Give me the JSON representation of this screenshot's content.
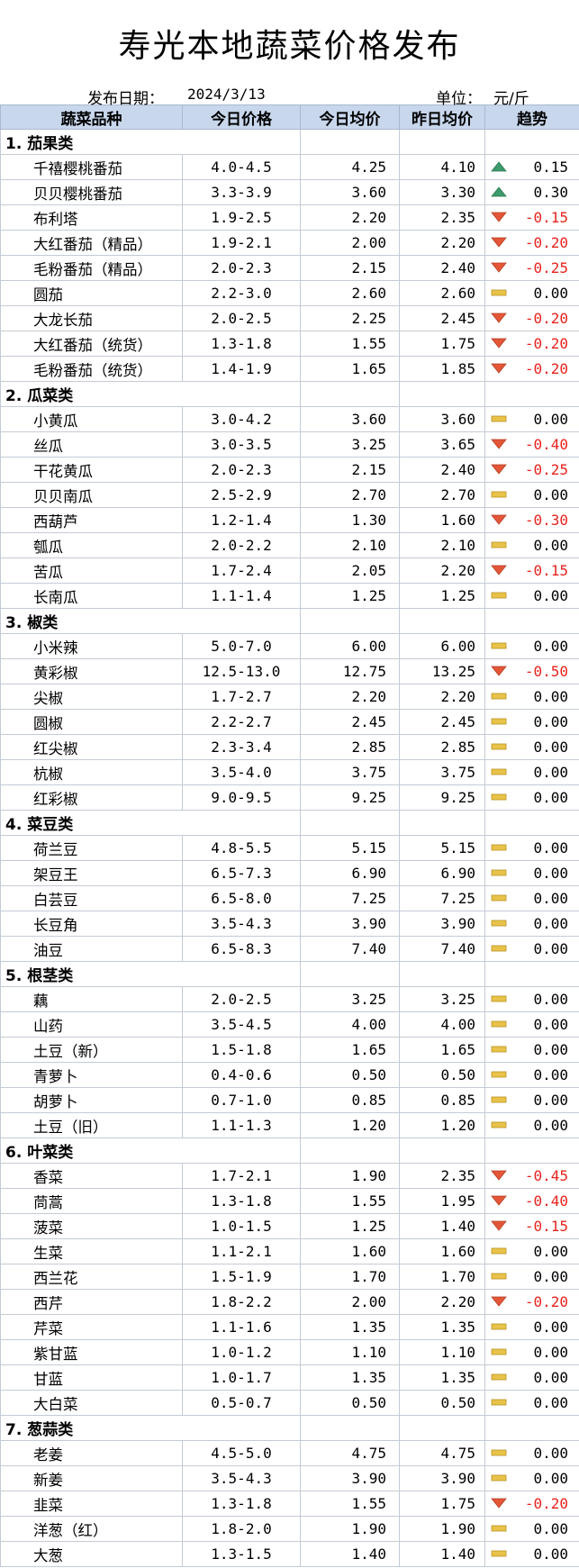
{
  "title": "寿光本地蔬菜价格发布",
  "date_label": "发布日期：",
  "date": "2024/3/13",
  "unit_label": "单位：",
  "unit": "元/斤",
  "headers": [
    "蔬菜品种",
    "今日价格",
    "今日均价",
    "昨日均价",
    "趋势"
  ],
  "colors": {
    "header_bg": "#c8d7ec",
    "up": "#3e9a6a",
    "down": "#e45638",
    "flat": "#e9c24a",
    "negative_text": "#e8231d"
  },
  "categories": [
    {
      "name": "1. 茄果类",
      "items": [
        {
          "name": "千禧樱桃番茄",
          "price": "4.0-4.5",
          "today": "4.25",
          "yesterday": "4.10",
          "trend": "up",
          "change": "0.15"
        },
        {
          "name": "贝贝樱桃番茄",
          "price": "3.3-3.9",
          "today": "3.60",
          "yesterday": "3.30",
          "trend": "up",
          "change": "0.30"
        },
        {
          "name": "布利塔",
          "price": "1.9-2.5",
          "today": "2.20",
          "yesterday": "2.35",
          "trend": "down",
          "change": "-0.15"
        },
        {
          "name": "大红番茄（精品）",
          "price": "1.9-2.1",
          "today": "2.00",
          "yesterday": "2.20",
          "trend": "down",
          "change": "-0.20"
        },
        {
          "name": "毛粉番茄（精品）",
          "price": "2.0-2.3",
          "today": "2.15",
          "yesterday": "2.40",
          "trend": "down",
          "change": "-0.25"
        },
        {
          "name": "圆茄",
          "price": "2.2-3.0",
          "today": "2.60",
          "yesterday": "2.60",
          "trend": "flat",
          "change": "0.00"
        },
        {
          "name": "大龙长茄",
          "price": "2.0-2.5",
          "today": "2.25",
          "yesterday": "2.45",
          "trend": "down",
          "change": "-0.20"
        },
        {
          "name": "大红番茄（统货）",
          "price": "1.3-1.8",
          "today": "1.55",
          "yesterday": "1.75",
          "trend": "down",
          "change": "-0.20"
        },
        {
          "name": "毛粉番茄（统货）",
          "price": "1.4-1.9",
          "today": "1.65",
          "yesterday": "1.85",
          "trend": "down",
          "change": "-0.20"
        }
      ]
    },
    {
      "name": "2. 瓜菜类",
      "items": [
        {
          "name": "小黄瓜",
          "price": "3.0-4.2",
          "today": "3.60",
          "yesterday": "3.60",
          "trend": "flat",
          "change": "0.00"
        },
        {
          "name": "丝瓜",
          "price": "3.0-3.5",
          "today": "3.25",
          "yesterday": "3.65",
          "trend": "down",
          "change": "-0.40"
        },
        {
          "name": "干花黄瓜",
          "price": "2.0-2.3",
          "today": "2.15",
          "yesterday": "2.40",
          "trend": "down",
          "change": "-0.25"
        },
        {
          "name": "贝贝南瓜",
          "price": "2.5-2.9",
          "today": "2.70",
          "yesterday": "2.70",
          "trend": "flat",
          "change": "0.00"
        },
        {
          "name": "西葫芦",
          "price": "1.2-1.4",
          "today": "1.30",
          "yesterday": "1.60",
          "trend": "down",
          "change": "-0.30"
        },
        {
          "name": "瓠瓜",
          "price": "2.0-2.2",
          "today": "2.10",
          "yesterday": "2.10",
          "trend": "flat",
          "change": "0.00"
        },
        {
          "name": "苦瓜",
          "price": "1.7-2.4",
          "today": "2.05",
          "yesterday": "2.20",
          "trend": "down",
          "change": "-0.15"
        },
        {
          "name": "长南瓜",
          "price": "1.1-1.4",
          "today": "1.25",
          "yesterday": "1.25",
          "trend": "flat",
          "change": "0.00"
        }
      ]
    },
    {
      "name": "3. 椒类",
      "items": [
        {
          "name": "小米辣",
          "price": "5.0-7.0",
          "today": "6.00",
          "yesterday": "6.00",
          "trend": "flat",
          "change": "0.00"
        },
        {
          "name": "黄彩椒",
          "price": "12.5-13.0",
          "today": "12.75",
          "yesterday": "13.25",
          "trend": "down",
          "change": "-0.50"
        },
        {
          "name": "尖椒",
          "price": "1.7-2.7",
          "today": "2.20",
          "yesterday": "2.20",
          "trend": "flat",
          "change": "0.00"
        },
        {
          "name": "圆椒",
          "price": "2.2-2.7",
          "today": "2.45",
          "yesterday": "2.45",
          "trend": "flat",
          "change": "0.00"
        },
        {
          "name": "红尖椒",
          "price": "2.3-3.4",
          "today": "2.85",
          "yesterday": "2.85",
          "trend": "flat",
          "change": "0.00"
        },
        {
          "name": "杭椒",
          "price": "3.5-4.0",
          "today": "3.75",
          "yesterday": "3.75",
          "trend": "flat",
          "change": "0.00"
        },
        {
          "name": "红彩椒",
          "price": "9.0-9.5",
          "today": "9.25",
          "yesterday": "9.25",
          "trend": "flat",
          "change": "0.00"
        }
      ]
    },
    {
      "name": "4. 菜豆类",
      "items": [
        {
          "name": "荷兰豆",
          "price": "4.8-5.5",
          "today": "5.15",
          "yesterday": "5.15",
          "trend": "flat",
          "change": "0.00"
        },
        {
          "name": "架豆王",
          "price": "6.5-7.3",
          "today": "6.90",
          "yesterday": "6.90",
          "trend": "flat",
          "change": "0.00"
        },
        {
          "name": "白芸豆",
          "price": "6.5-8.0",
          "today": "7.25",
          "yesterday": "7.25",
          "trend": "flat",
          "change": "0.00"
        },
        {
          "name": "长豆角",
          "price": "3.5-4.3",
          "today": "3.90",
          "yesterday": "3.90",
          "trend": "flat",
          "change": "0.00"
        },
        {
          "name": "油豆",
          "price": "6.5-8.3",
          "today": "7.40",
          "yesterday": "7.40",
          "trend": "flat",
          "change": "0.00"
        }
      ]
    },
    {
      "name": "5. 根茎类",
      "items": [
        {
          "name": "藕",
          "price": "2.0-2.5",
          "today": "3.25",
          "yesterday": "3.25",
          "trend": "flat",
          "change": "0.00"
        },
        {
          "name": "山药",
          "price": "3.5-4.5",
          "today": "4.00",
          "yesterday": "4.00",
          "trend": "flat",
          "change": "0.00"
        },
        {
          "name": "土豆（新）",
          "price": "1.5-1.8",
          "today": "1.65",
          "yesterday": "1.65",
          "trend": "flat",
          "change": "0.00"
        },
        {
          "name": "青萝卜",
          "price": "0.4-0.6",
          "today": "0.50",
          "yesterday": "0.50",
          "trend": "flat",
          "change": "0.00"
        },
        {
          "name": "胡萝卜",
          "price": "0.7-1.0",
          "today": "0.85",
          "yesterday": "0.85",
          "trend": "flat",
          "change": "0.00"
        },
        {
          "name": "土豆（旧）",
          "price": "1.1-1.3",
          "today": "1.20",
          "yesterday": "1.20",
          "trend": "flat",
          "change": "0.00"
        }
      ]
    },
    {
      "name": "6. 叶菜类",
      "items": [
        {
          "name": "香菜",
          "price": "1.7-2.1",
          "today": "1.90",
          "yesterday": "2.35",
          "trend": "down",
          "change": "-0.45"
        },
        {
          "name": "茼蒿",
          "price": "1.3-1.8",
          "today": "1.55",
          "yesterday": "1.95",
          "trend": "down",
          "change": "-0.40"
        },
        {
          "name": "菠菜",
          "price": "1.0-1.5",
          "today": "1.25",
          "yesterday": "1.40",
          "trend": "down",
          "change": "-0.15"
        },
        {
          "name": "生菜",
          "price": "1.1-2.1",
          "today": "1.60",
          "yesterday": "1.60",
          "trend": "flat",
          "change": "0.00"
        },
        {
          "name": "西兰花",
          "price": "1.5-1.9",
          "today": "1.70",
          "yesterday": "1.70",
          "trend": "flat",
          "change": "0.00"
        },
        {
          "name": "西芹",
          "price": "1.8-2.2",
          "today": "2.00",
          "yesterday": "2.20",
          "trend": "down",
          "change": "-0.20"
        },
        {
          "name": "芹菜",
          "price": "1.1-1.6",
          "today": "1.35",
          "yesterday": "1.35",
          "trend": "flat",
          "change": "0.00"
        },
        {
          "name": "紫甘蓝",
          "price": "1.0-1.2",
          "today": "1.10",
          "yesterday": "1.10",
          "trend": "flat",
          "change": "0.00"
        },
        {
          "name": "甘蓝",
          "price": "1.0-1.7",
          "today": "1.35",
          "yesterday": "1.35",
          "trend": "flat",
          "change": "0.00"
        },
        {
          "name": "大白菜",
          "price": "0.5-0.7",
          "today": "0.50",
          "yesterday": "0.50",
          "trend": "flat",
          "change": "0.00"
        }
      ]
    },
    {
      "name": "7. 葱蒜类",
      "items": [
        {
          "name": "老姜",
          "price": "4.5-5.0",
          "today": "4.75",
          "yesterday": "4.75",
          "trend": "flat",
          "change": "0.00"
        },
        {
          "name": "新姜",
          "price": "3.5-4.3",
          "today": "3.90",
          "yesterday": "3.90",
          "trend": "flat",
          "change": "0.00"
        },
        {
          "name": "韭菜",
          "price": "1.3-1.8",
          "today": "1.55",
          "yesterday": "1.75",
          "trend": "down",
          "change": "-0.20"
        },
        {
          "name": "洋葱（红）",
          "price": "1.8-2.0",
          "today": "1.90",
          "yesterday": "1.90",
          "trend": "flat",
          "change": "0.00"
        },
        {
          "name": "大葱",
          "price": "1.3-1.5",
          "today": "1.40",
          "yesterday": "1.40",
          "trend": "flat",
          "change": "0.00"
        }
      ]
    }
  ]
}
